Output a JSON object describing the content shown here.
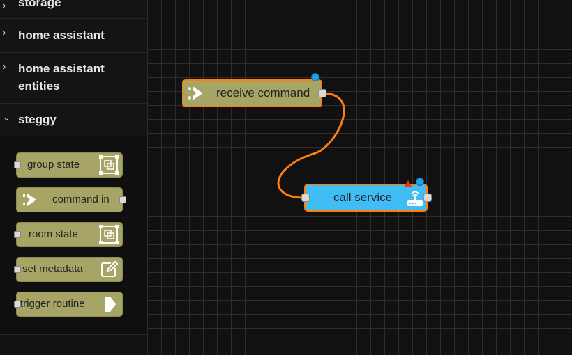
{
  "palette": {
    "categories": [
      {
        "label": "storage",
        "expanded": false
      },
      {
        "label": "home assistant",
        "expanded": false
      },
      {
        "label_line1": "home assistant",
        "label_line2": "entities",
        "expanded": false
      },
      {
        "label": "steggy",
        "expanded": true
      }
    ],
    "nodes": [
      {
        "label": "group state",
        "icon": "group-state-icon"
      },
      {
        "label": "command in",
        "icon": "arrow-right-icon"
      },
      {
        "label": "room state",
        "icon": "room-state-icon"
      },
      {
        "label": "set metadata",
        "icon": "edit-icon"
      },
      {
        "label": "trigger routine",
        "icon": "trigger-icon"
      }
    ]
  },
  "flow": {
    "nodes": [
      {
        "label": "receive command",
        "color": "#a6a566",
        "icon": "arrow-right-icon"
      },
      {
        "label": "call service",
        "color": "#41bdf5",
        "icon": "router-icon"
      }
    ],
    "colors": {
      "selected_border": "#ff7f0e",
      "wire": "#ff7f0e",
      "status_dot": "#1aa3e8",
      "warning": "#ff3300"
    }
  }
}
